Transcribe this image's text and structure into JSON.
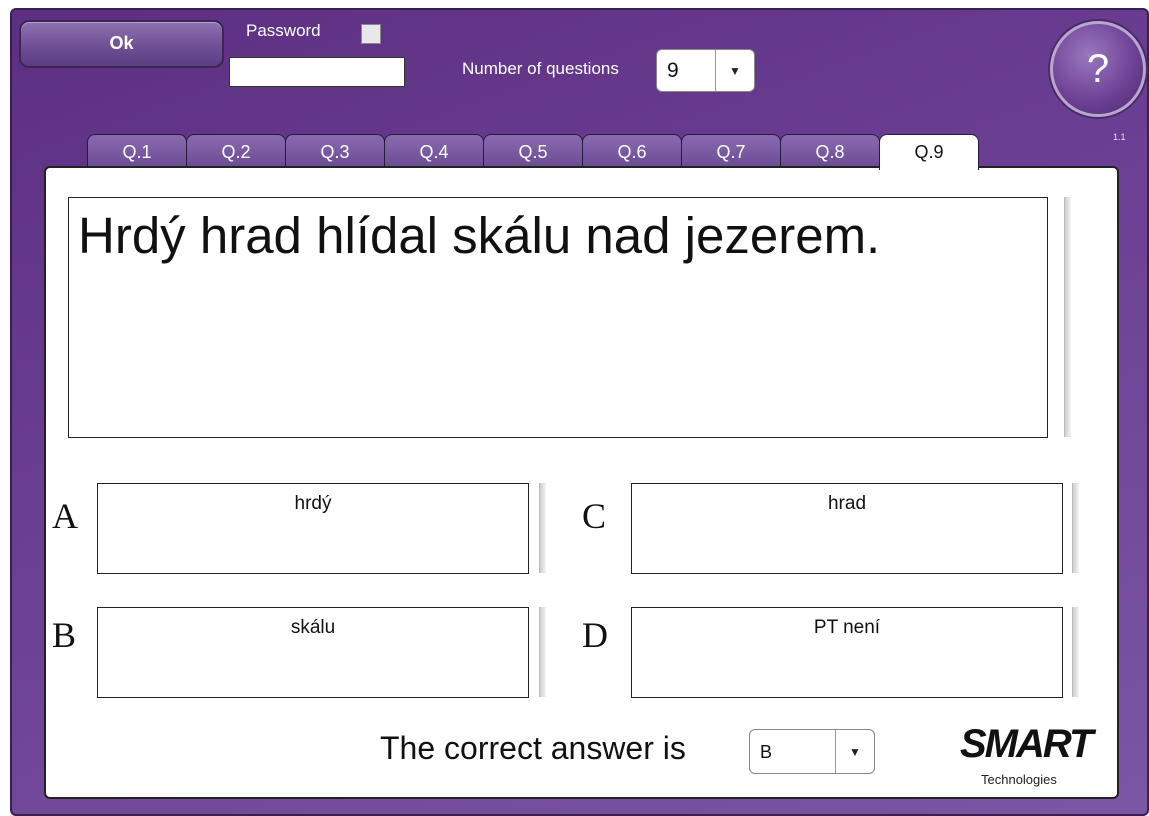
{
  "toolbar": {
    "ok_label": "Ok",
    "password_label": "Password",
    "password_value": "",
    "num_questions_label": "Number of questions",
    "num_questions_value": "9",
    "help_label": "?",
    "version": "1.1"
  },
  "tabs": [
    {
      "label": "Q.1"
    },
    {
      "label": "Q.2"
    },
    {
      "label": "Q.3"
    },
    {
      "label": "Q.4"
    },
    {
      "label": "Q.5"
    },
    {
      "label": "Q.6"
    },
    {
      "label": "Q.7"
    },
    {
      "label": "Q.8"
    },
    {
      "label": "Q.9",
      "active": true
    }
  ],
  "question": {
    "text": "Hrdý hrad hlídal skálu nad jezerem."
  },
  "options": [
    {
      "letter": "A",
      "text": "hrdý"
    },
    {
      "letter": "B",
      "text": "skálu"
    },
    {
      "letter": "C",
      "text": "hrad"
    },
    {
      "letter": "D",
      "text": "PT není"
    }
  ],
  "answer": {
    "label": "The correct answer is",
    "value": "B"
  },
  "logo": {
    "word": "SMART",
    "sub": "Technologies"
  }
}
